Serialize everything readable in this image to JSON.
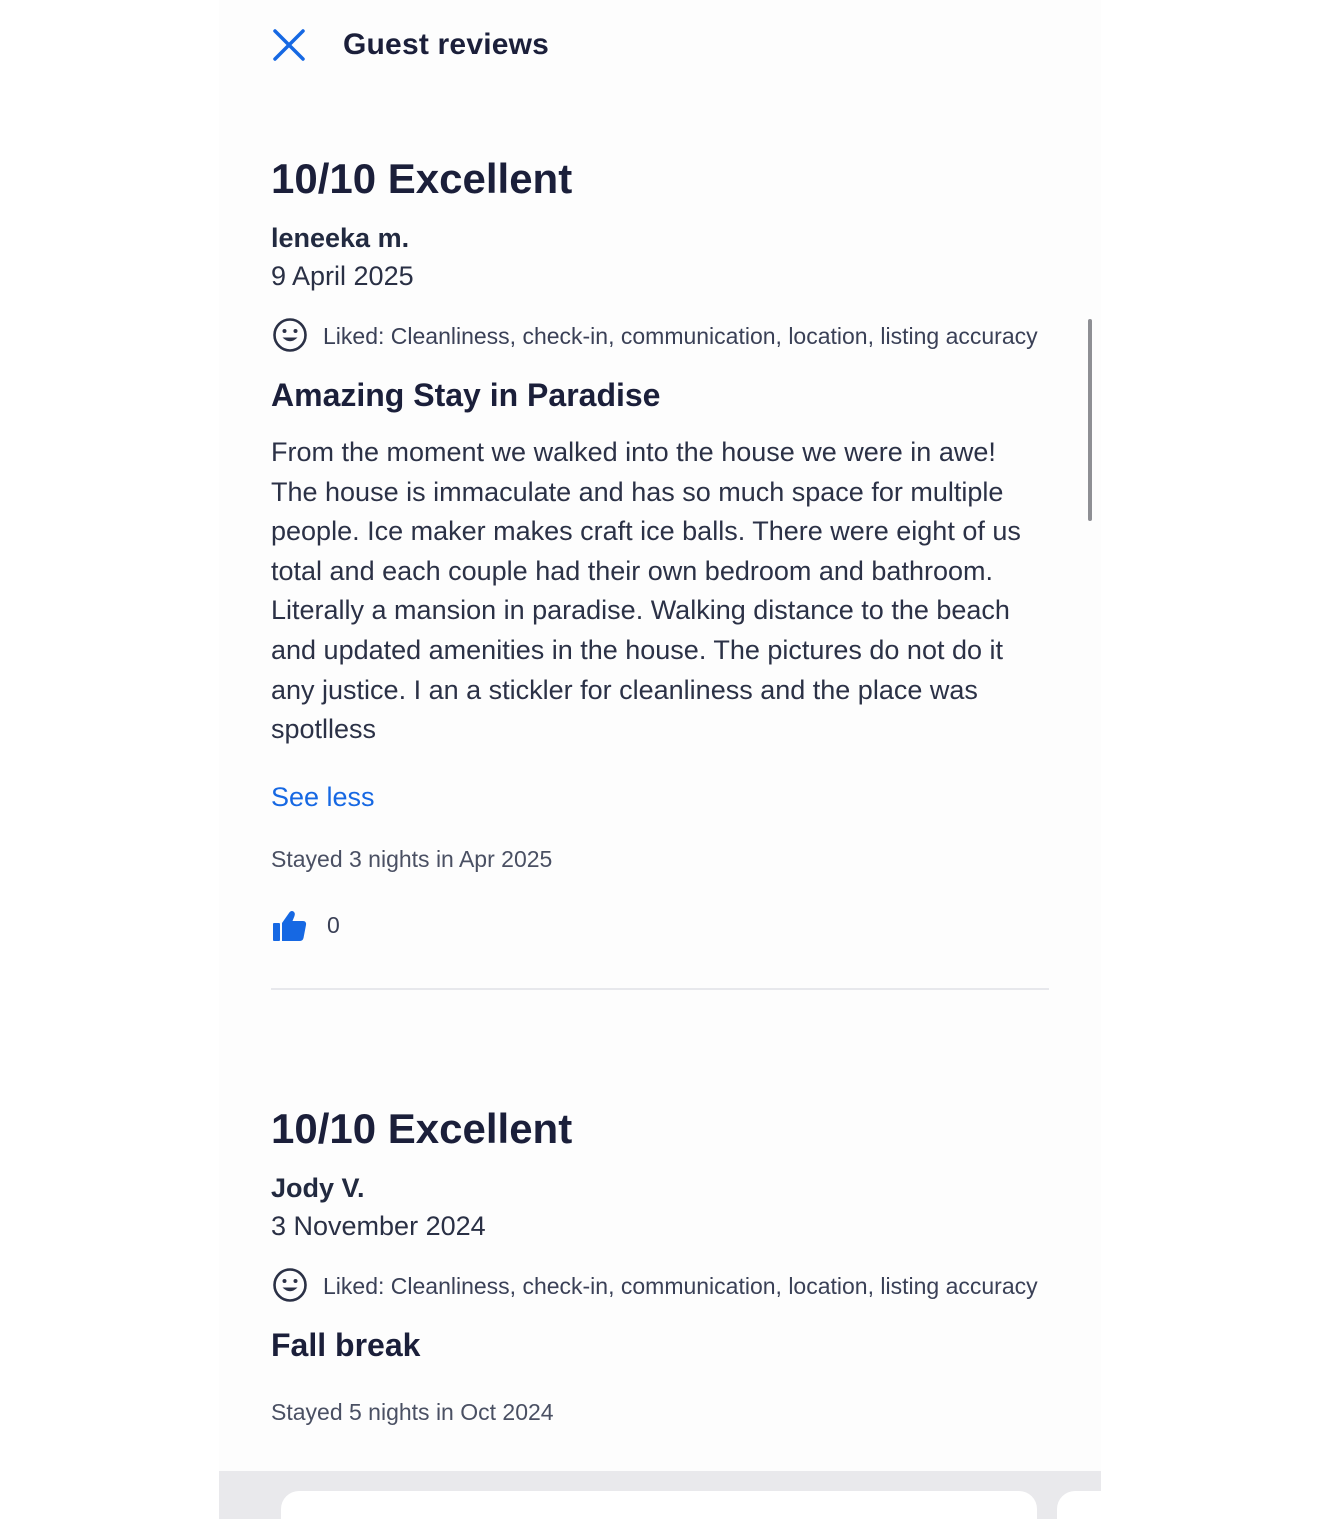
{
  "header": {
    "title": "Guest reviews",
    "close_icon": "close-icon"
  },
  "colors": {
    "accent": "#1668e3",
    "text": "#1b1f3a",
    "divider": "#e7e8ec"
  },
  "reviews": [
    {
      "score": "10/10 Excellent",
      "author": "leneeka m.",
      "date": "9 April 2025",
      "liked": "Liked: Cleanliness, check-in, communication, location, listing accuracy",
      "title": "Amazing Stay in Paradise",
      "body": "From the moment we walked into the house we were in awe! The house is immaculate and has so much space for multiple people. Ice maker makes craft ice balls. There were eight of us total and each couple had their own bedroom and bathroom. Literally a mansion in paradise. Walking distance to the beach and updated amenities in the house. The pictures do not do it any justice. I an a stickler for cleanliness and the place was spotlless",
      "see_less": "See less",
      "stayed": "Stayed 3 nights in Apr 2025",
      "helpful_count": "0"
    },
    {
      "score": "10/10 Excellent",
      "author": "Jody V.",
      "date": "3 November 2024",
      "liked": "Liked: Cleanliness, check-in, communication, location, listing accuracy",
      "title": "Fall break",
      "stayed": "Stayed 5 nights in Oct 2024"
    }
  ]
}
